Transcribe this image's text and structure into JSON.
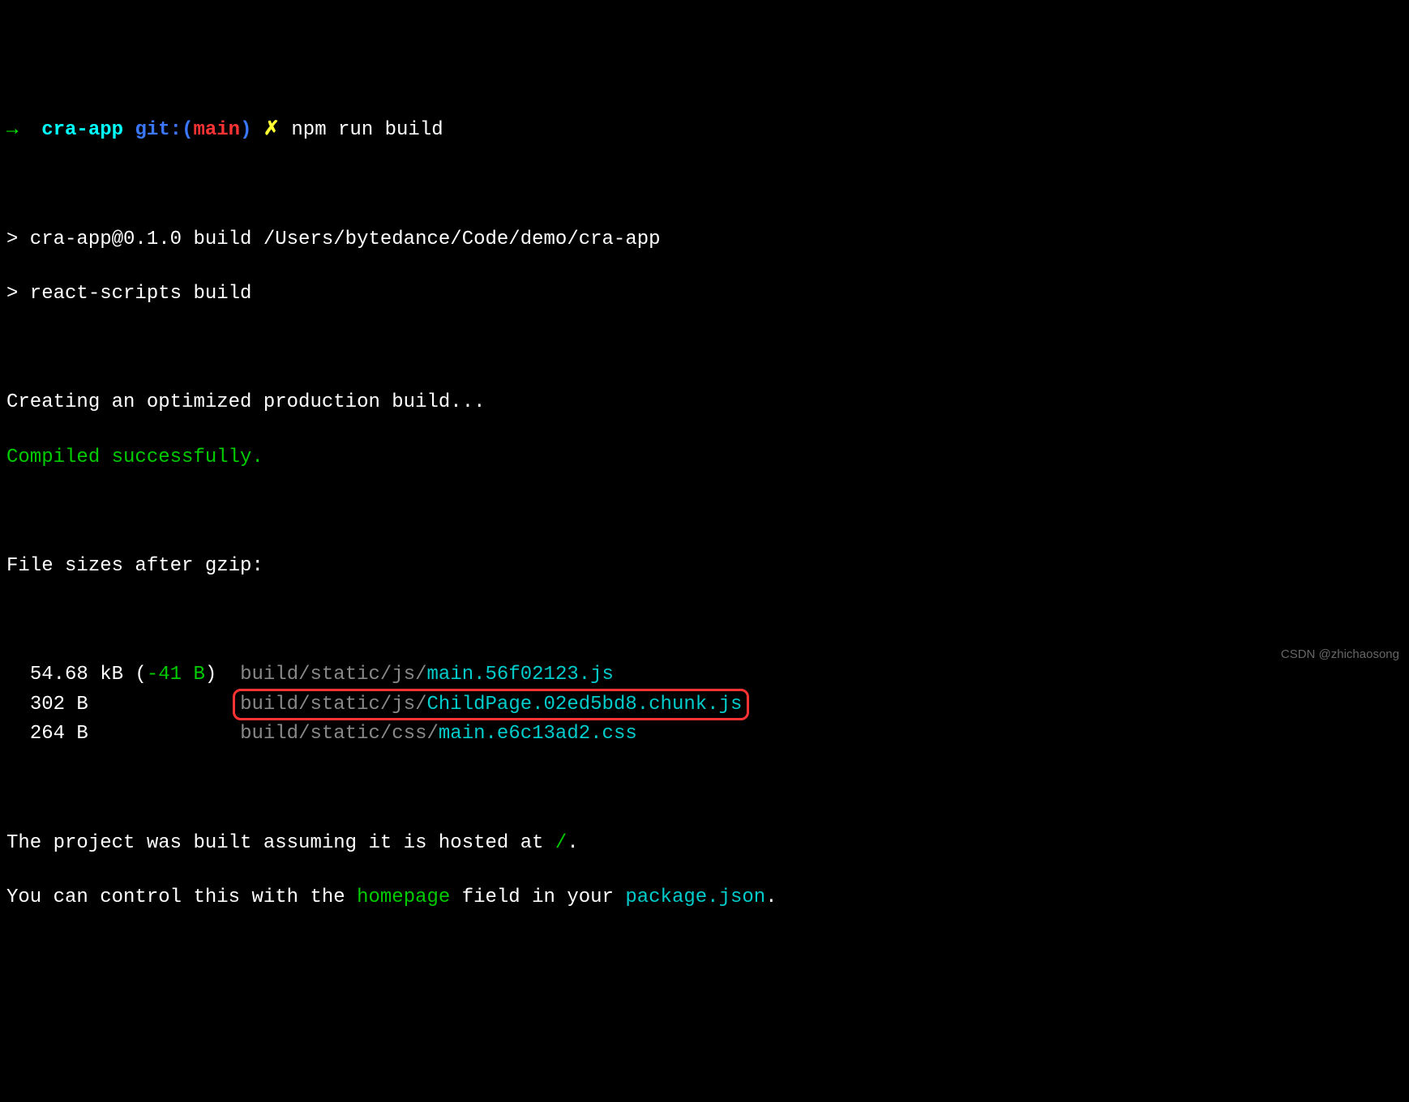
{
  "prompt": {
    "arrow": "→",
    "dir": "cra-app",
    "git_prefix": "git:(",
    "branch": "main",
    "git_suffix": ")",
    "symbol": "✗",
    "command": "npm run build"
  },
  "script_lines": {
    "line1": "> cra-app@0.1.0 build /Users/bytedance/Code/demo/cra-app",
    "line2": "> react-scripts build"
  },
  "status": {
    "creating": "Creating an optimized production build...",
    "compiled": "Compiled successfully."
  },
  "gzip_header": "File sizes after gzip:",
  "files": [
    {
      "size": "54.68 kB",
      "delta_open": " (",
      "delta": "-41 B",
      "delta_close": ")",
      "pad": "  ",
      "path": "build/static/js/",
      "name": "main.56f02123.js",
      "highlighted": false
    },
    {
      "size": "302 B",
      "delta_open": "",
      "delta": "",
      "delta_close": "",
      "pad": "             ",
      "path": "build/static/js/",
      "name": "ChildPage.02ed5bd8.chunk.js",
      "highlighted": true
    },
    {
      "size": "264 B",
      "delta_open": "",
      "delta": "",
      "delta_close": "",
      "pad": "             ",
      "path": "build/static/css/",
      "name": "main.e6c13ad2.css",
      "highlighted": false
    }
  ],
  "footer": {
    "line1_a": "The project was built assuming it is hosted at ",
    "line1_b": "/",
    "line1_c": ".",
    "line2_a": "You can control this with the ",
    "line2_b": "homepage",
    "line2_c": " field in your ",
    "line2_d": "package.json",
    "line2_e": "."
  },
  "watermark": "CSDN @zhichaosong"
}
